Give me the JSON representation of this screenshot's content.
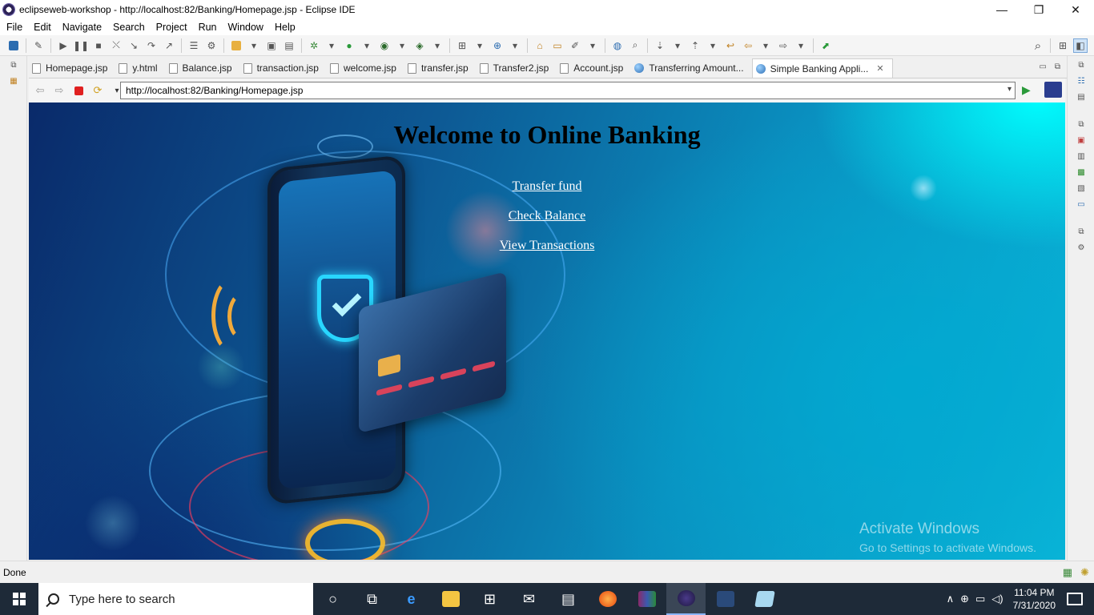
{
  "window": {
    "title": "eclipseweb-workshop - http://localhost:82/Banking/Homepage.jsp - Eclipse IDE",
    "controls": {
      "minimize": "—",
      "restore": "❐",
      "close": "✕"
    }
  },
  "menu": {
    "items": [
      "File",
      "Edit",
      "Navigate",
      "Search",
      "Project",
      "Run",
      "Window",
      "Help"
    ]
  },
  "tabs": [
    {
      "label": "Homepage.jsp",
      "icon": "jsp-file-icon"
    },
    {
      "label": "y.html",
      "icon": "html-file-icon"
    },
    {
      "label": "Balance.jsp",
      "icon": "jsp-file-icon"
    },
    {
      "label": "transaction.jsp",
      "icon": "jsp-file-icon"
    },
    {
      "label": "welcome.jsp",
      "icon": "jsp-file-icon"
    },
    {
      "label": "transfer.jsp",
      "icon": "jsp-file-icon"
    },
    {
      "label": "Transfer2.jsp",
      "icon": "jsp-file-icon"
    },
    {
      "label": "Account.jsp",
      "icon": "jsp-file-icon"
    },
    {
      "label": "Transferring Amount...",
      "icon": "globe-icon"
    },
    {
      "label": "Simple Banking Appli...",
      "icon": "globe-icon",
      "active": true
    }
  ],
  "browser": {
    "url": "http://localhost:82/Banking/Homepage.jsp"
  },
  "page": {
    "heading": "Welcome to Online Banking",
    "links": [
      "Transfer fund",
      "Check Balance",
      "View Transactions"
    ]
  },
  "watermark": {
    "line1": "Activate Windows",
    "line2": "Go to Settings to activate Windows."
  },
  "status": {
    "text": "Done"
  },
  "taskbar": {
    "search_placeholder": "Type here to search",
    "time": "11:04 PM",
    "date": "7/31/2020"
  }
}
